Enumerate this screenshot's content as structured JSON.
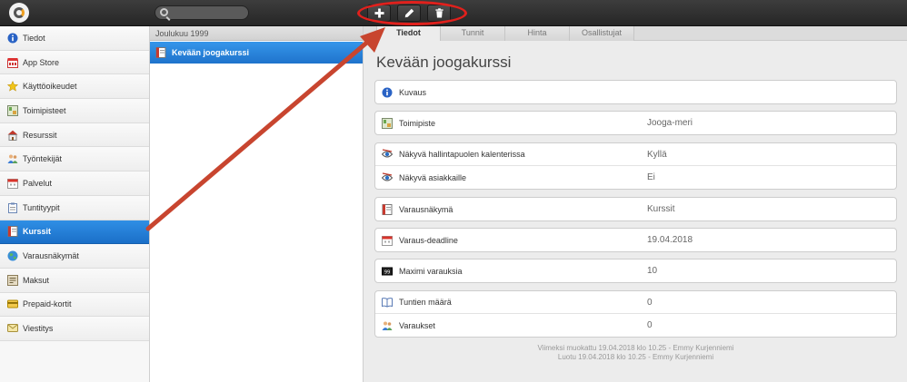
{
  "toolbar": {
    "add_icon": "plus-icon",
    "edit_icon": "pencil-icon",
    "delete_icon": "trash-icon",
    "search_placeholder": ""
  },
  "sidebar": {
    "items": [
      {
        "label": "Tiedot",
        "icon": "info-icon",
        "active": false
      },
      {
        "label": "App Store",
        "icon": "store-icon",
        "active": false
      },
      {
        "label": "Käyttöoikeudet",
        "icon": "star-icon",
        "active": false
      },
      {
        "label": "Toimipisteet",
        "icon": "location-icon",
        "active": false
      },
      {
        "label": "Resurssit",
        "icon": "house-icon",
        "active": false
      },
      {
        "label": "Työntekijät",
        "icon": "people-icon",
        "active": false
      },
      {
        "label": "Palvelut",
        "icon": "calendar-icon",
        "active": false
      },
      {
        "label": "Tuntityypit",
        "icon": "clipboard-icon",
        "active": false
      },
      {
        "label": "Kurssit",
        "icon": "book-icon",
        "active": true
      },
      {
        "label": "Varausnäkymät",
        "icon": "globe-icon",
        "active": false
      },
      {
        "label": "Maksut",
        "icon": "invoice-icon",
        "active": false
      },
      {
        "label": "Prepaid-kortit",
        "icon": "card-icon",
        "active": false
      },
      {
        "label": "Viestitys",
        "icon": "message-icon",
        "active": false
      }
    ]
  },
  "list": {
    "header": "Joulukuu 1999",
    "items": [
      {
        "label": "Kevään joogakurssi",
        "icon": "book-icon"
      }
    ]
  },
  "tabs": [
    "Tiedot",
    "Tunnit",
    "Hinta",
    "Osallistujat"
  ],
  "detail": {
    "title": "Kevään joogakurssi",
    "groups": [
      [
        {
          "label": "Kuvaus",
          "value": "",
          "icon": "info-icon"
        }
      ],
      [
        {
          "label": "Toimipiste",
          "value": "Jooga-meri",
          "icon": "location-icon"
        }
      ],
      [
        {
          "label": "Näkyvä hallintapuolen kalenterissa",
          "value": "Kyllä",
          "icon": "eye-icon"
        },
        {
          "label": "Näkyvä asiakkaille",
          "value": "Ei",
          "icon": "eye-icon"
        }
      ],
      [
        {
          "label": "Varausnäkymä",
          "value": "Kurssit",
          "icon": "book-icon"
        }
      ],
      [
        {
          "label": "Varaus-deadline",
          "value": "19.04.2018",
          "icon": "calendar-icon"
        }
      ],
      [
        {
          "label": "Maximi varauksia",
          "value": "10",
          "icon": "counter-icon"
        }
      ],
      [
        {
          "label": "Tuntien määrä",
          "value": "0",
          "icon": "open-book-icon"
        },
        {
          "label": "Varaukset",
          "value": "0",
          "icon": "people-icon"
        }
      ]
    ],
    "footer": [
      "Viimeksi muokattu 19.04.2018 klo 10.25 - Emmy Kurjenniemi",
      "Luotu 19.04.2018 klo 10.25 - Emmy Kurjenniemi"
    ]
  },
  "colors": {
    "accent": "#1f73cc",
    "annotation": "#c8452f",
    "highlight": "#e1201c"
  }
}
